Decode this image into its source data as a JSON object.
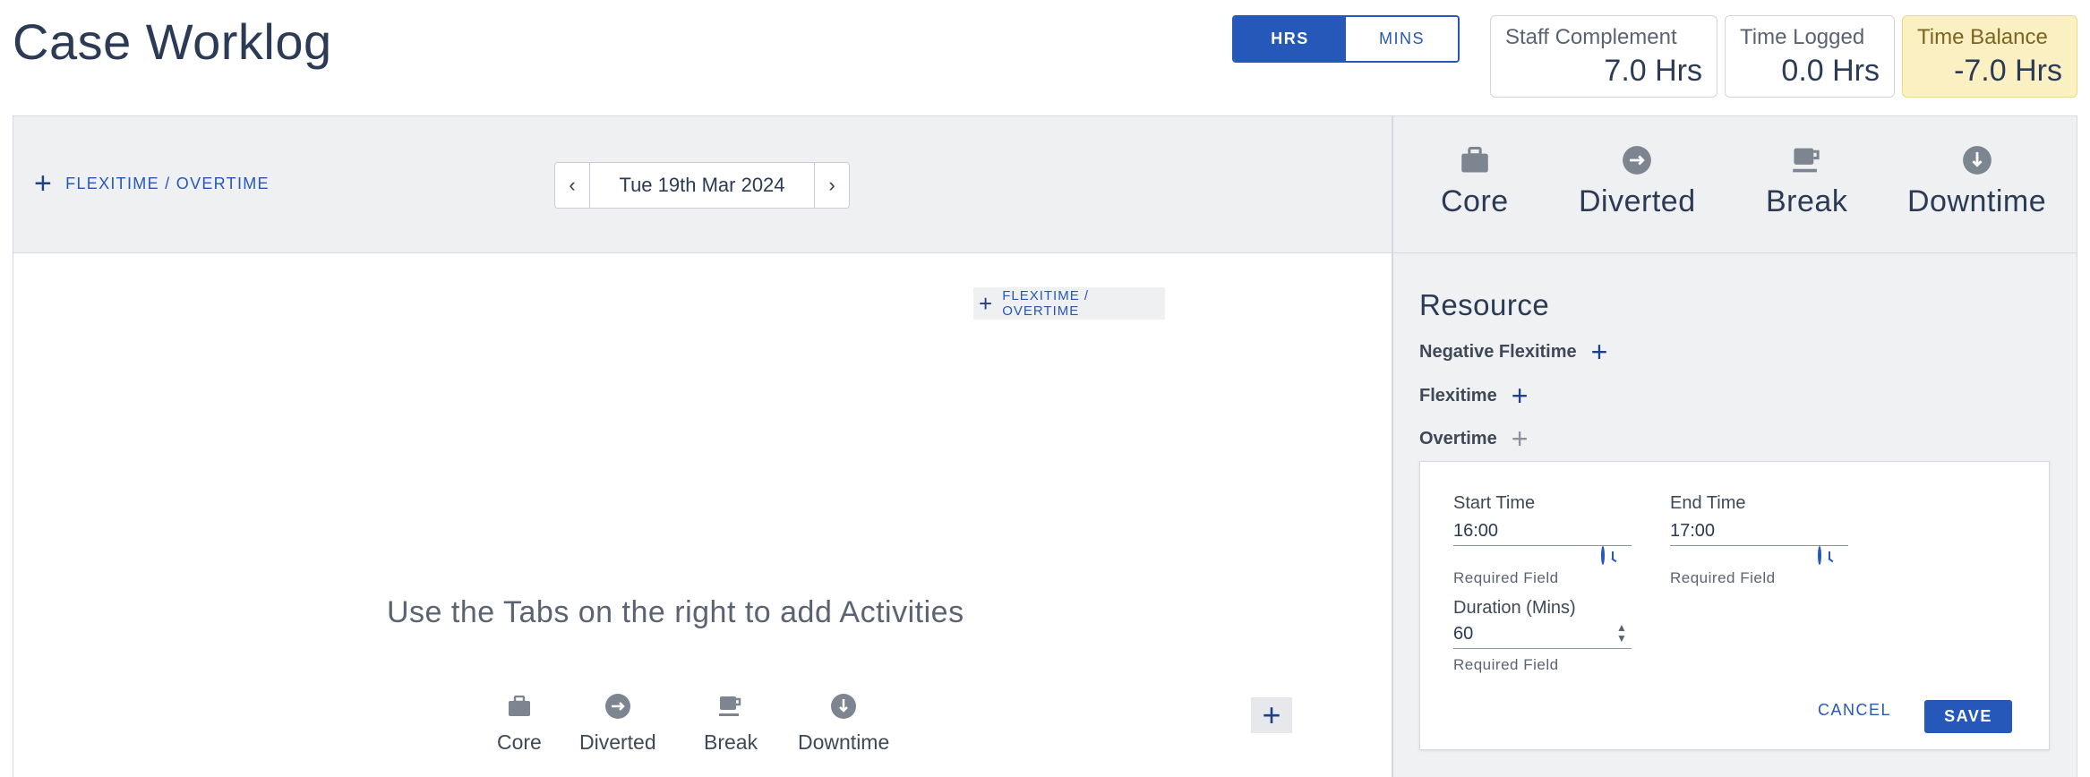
{
  "page": {
    "title": "Case Worklog"
  },
  "unit_toggle": {
    "hrs": "HRS",
    "mins": "MINS",
    "selected": "HRS"
  },
  "stats": {
    "staff_complement": {
      "label": "Staff Complement",
      "value": "7.0 Hrs"
    },
    "time_logged": {
      "label": "Time Logged",
      "value": "0.0 Hrs"
    },
    "time_balance": {
      "label": "Time Balance",
      "value": "-7.0 Hrs"
    }
  },
  "toolbar": {
    "flexi_label": "FLEXITIME / OVERTIME",
    "date": "Tue 19th Mar 2024",
    "prev": "‹",
    "next": "›"
  },
  "main": {
    "inline_flexi_label": "FLEXITIME / OVERTIME",
    "empty_message": "Use the Tabs on the right to add Activities"
  },
  "activity_tabs": [
    {
      "label": "Core",
      "icon": "briefcase-icon"
    },
    {
      "label": "Diverted",
      "icon": "arrow-right-circle-icon"
    },
    {
      "label": "Break",
      "icon": "coffee-cup-icon"
    },
    {
      "label": "Downtime",
      "icon": "arrow-down-circle-icon"
    }
  ],
  "resource": {
    "title": "Resource",
    "items": [
      {
        "label": "Negative Flexitime"
      },
      {
        "label": "Flexitime"
      },
      {
        "label": "Overtime"
      }
    ]
  },
  "form": {
    "start_time": {
      "label": "Start Time",
      "value": "16:00",
      "help": "Required Field"
    },
    "end_time": {
      "label": "End Time",
      "value": "17:00",
      "help": "Required Field"
    },
    "duration": {
      "label": "Duration (Mins)",
      "value": "60",
      "help": "Required Field"
    },
    "cancel_label": "CANCEL",
    "save_label": "SAVE"
  },
  "colors": {
    "accent": "#2558b8",
    "text": "#2b3a55",
    "panel": "#eef0f2",
    "balance_warning": "#fbf0c2",
    "icon_gray": "#7d8591"
  }
}
